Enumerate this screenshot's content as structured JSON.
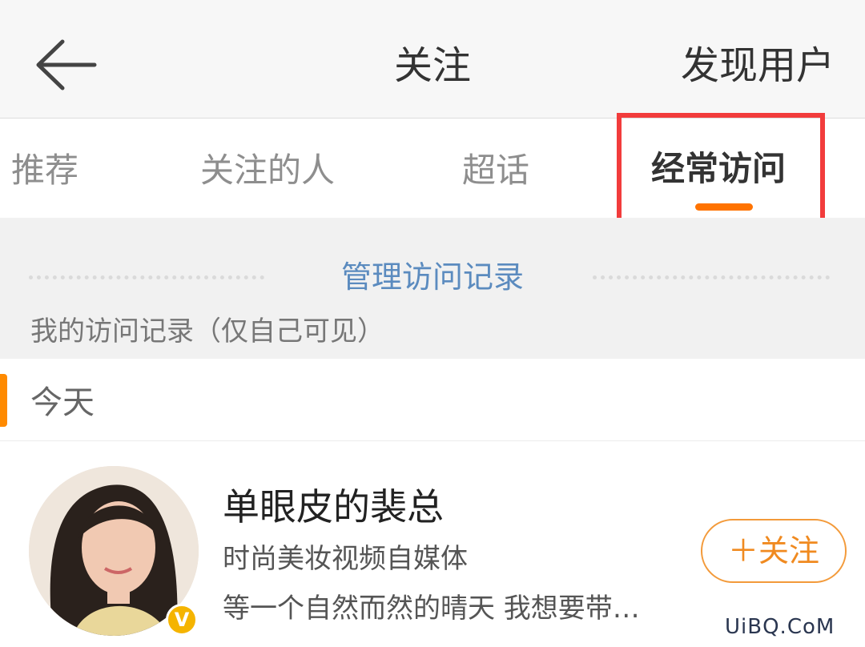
{
  "header": {
    "back_icon": "arrow-left-icon",
    "title": "关注",
    "discover_label": "发现用户"
  },
  "tabs": [
    {
      "label": "推荐",
      "active": false
    },
    {
      "label": "关注的人",
      "active": false
    },
    {
      "label": "超话",
      "active": false
    },
    {
      "label": "经常访问",
      "active": true
    }
  ],
  "colors": {
    "accent": "#ff7300",
    "highlight_box": "#f23c3c",
    "link": "#5b8bbf"
  },
  "visits": {
    "manage_label": "管理访问记录",
    "privacy_note": "我的访问记录（仅自己可见）",
    "section_label": "今天"
  },
  "user": {
    "name": "单眼皮的裴总",
    "description": "时尚美妆视频自媒体",
    "bio": "等一个自然而然的晴天 我想要带…",
    "verified_badge": "V",
    "follow_label": "＋关注"
  },
  "watermark": "UiBQ.CoM"
}
